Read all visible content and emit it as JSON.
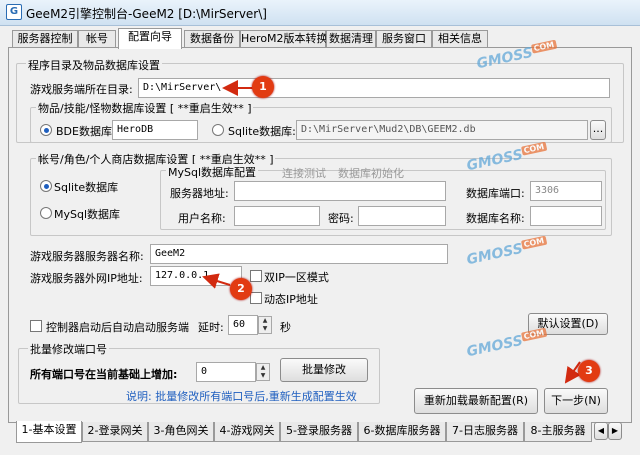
{
  "window": {
    "title": "GeeM2引擎控制台-GeeM2 [D:\\MirServer\\]"
  },
  "top_tabs": [
    "服务器控制",
    "帐号",
    "配置向导",
    "数据备份",
    "HeroM2版本转换",
    "数据清理",
    "服务窗口",
    "相关信息"
  ],
  "section_dirs": {
    "title": "程序目录及物品数据库设置",
    "game_dir_label": "游戏服务端所在目录:",
    "game_dir_value": "D:\\MirServer\\"
  },
  "item_db": {
    "title": "物品/技能/怪物数据库设置 [ **重启生效** ]",
    "bde_label": "BDE数据库:",
    "bde_value": "HeroDB",
    "sqlite_label": "Sqlite数据库:",
    "sqlite_value": "D:\\MirServer\\Mud2\\DB\\GEEM2.db",
    "browse_label": "..."
  },
  "account_db": {
    "title": "帐号/角色/个人商店数据库设置 [ **重启生效** ]",
    "sqlite_label": "Sqlite数据库",
    "mysql_label": "MySql数据库",
    "mysql_group_title": "MySql数据库配置",
    "test_conn": "连接测试",
    "db_init": "数据库初始化",
    "server_addr_label": "服务器地址:",
    "port_label": "数据库端口:",
    "port_value": "3306",
    "username_label": "用户名称:",
    "password_label": "密码:",
    "dbname_label": "数据库名称:"
  },
  "server": {
    "name_label": "游戏服务器服务器名称:",
    "name_value": "GeeM2",
    "ip_label": "游戏服务器外网IP地址:",
    "ip_value": "127.0.0.1",
    "dual_ip_label": "双IP一区模式",
    "dynamic_ip_label": "动态IP地址"
  },
  "autostart": {
    "label": "控制器启动后自动启动服务端",
    "delay_label": "延时:",
    "delay_value": "60",
    "unit": "秒"
  },
  "default_btn": "默认设置(D)",
  "batch": {
    "title": "批量修改端口号",
    "port_label": "所有端口号在当前基础上增加:",
    "port_value": "0",
    "btn": "批量修改",
    "note": "说明: 批量修改所有端口号后,重新生成配置生效"
  },
  "reload_btn": "重新加载最新配置(R)",
  "next_btn": "下一步(N)",
  "badges": [
    "1",
    "2",
    "3"
  ],
  "watermark": {
    "text": "GMOSS",
    "tag": "COM"
  },
  "bottom_tabs": [
    "1-基本设置",
    "2-登录网关",
    "3-角色网关",
    "4-游戏网关",
    "5-登录服务器",
    "6-数据库服务器",
    "7-日志服务器",
    "8-主服务器"
  ],
  "colors": {
    "badge": "#e23b12",
    "arrow": "#d22a10",
    "note": "#1f5fbf",
    "disabled": "#999999"
  }
}
